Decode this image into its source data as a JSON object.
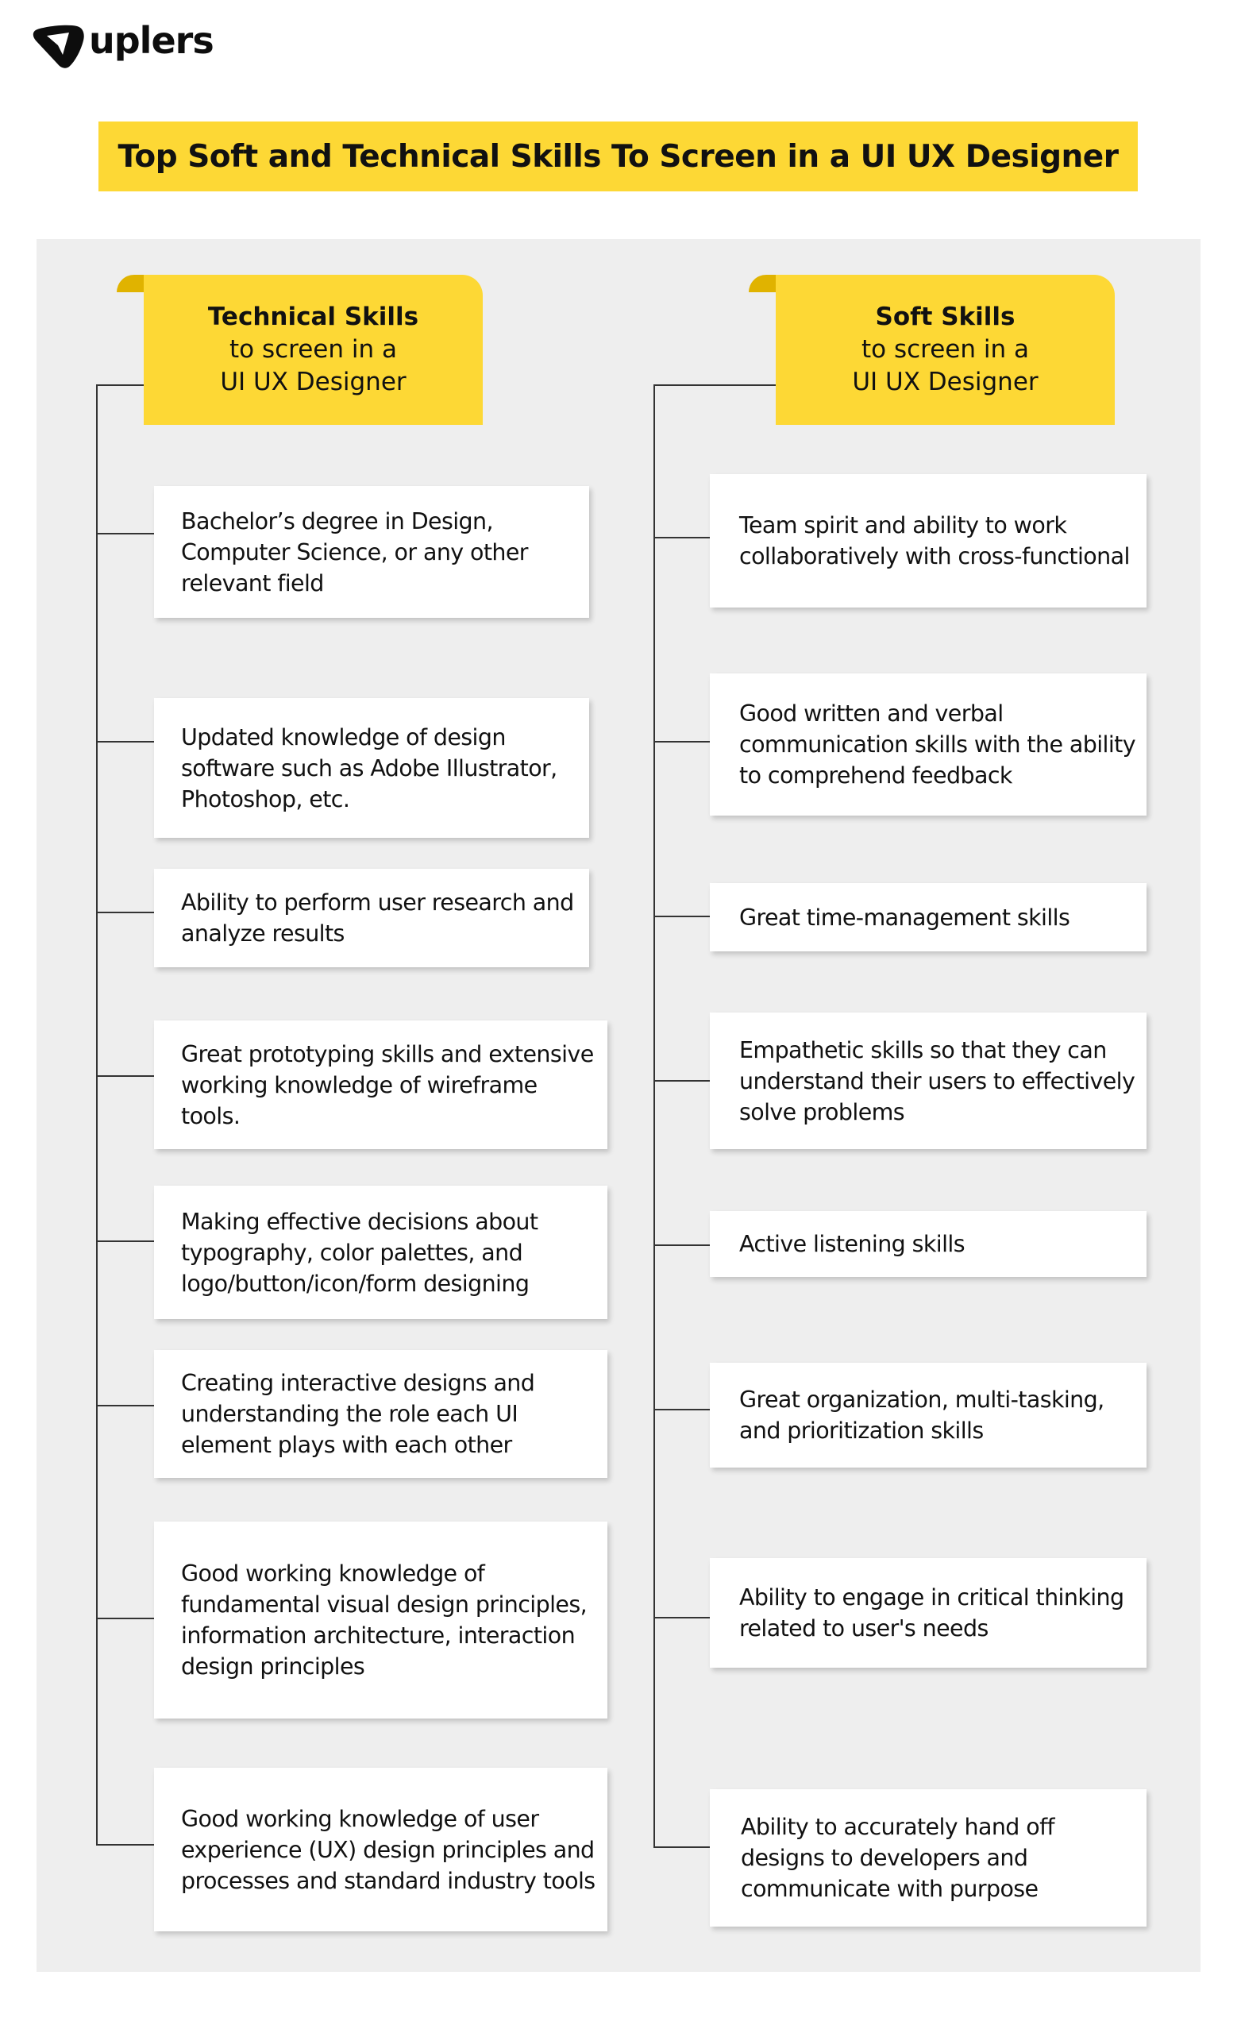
{
  "brand": {
    "logo_icon": "paper-plane-pointer-icon",
    "name": "uplers"
  },
  "title": "Top Soft and Technical Skills To Screen in a UI UX Designer",
  "colors": {
    "accent_yellow": "#fdd835",
    "curl_yellow": "#e0b300",
    "panel_gray": "#eeeeee",
    "line": "#333333",
    "text": "#111111"
  },
  "technical": {
    "heading_bold": "Technical Skills",
    "heading_line2": "to screen in a",
    "heading_line3": "UI UX Designer",
    "items": [
      "Bachelor’s degree in Design, Computer Science, or any other relevant field",
      "Updated knowledge of design software such as Adobe Illustrator, Photoshop, etc.",
      "Ability to perform user research and analyze results",
      "Great prototyping skills and extensive working knowledge of wireframe tools.",
      "Making effective decisions about typography, color palettes, and logo/button/icon/form designing",
      "Creating interactive designs and understanding the role each UI element plays with each other",
      "Good working knowledge of fundamental visual design principles, information architecture, interaction design principles",
      "Good working knowledge of user experience (UX) design principles and processes and standard industry tools"
    ]
  },
  "soft": {
    "heading_bold": "Soft Skills",
    "heading_line2": "to screen in a",
    "heading_line3": "UI UX Designer",
    "items": [
      "Team spirit and ability to work collaboratively with cross-functional",
      "Good written and verbal communication skills with the ability to comprehend feedback",
      "Great time-management skills",
      "Empathetic skills so that they can understand their users to effectively solve problems",
      "Active listening skills",
      "Great organization, multi-tasking, and prioritization skills",
      "Ability to engage in critical thinking related to user's needs",
      "Ability to accurately hand off designs to developers and communicate with purpose"
    ]
  }
}
